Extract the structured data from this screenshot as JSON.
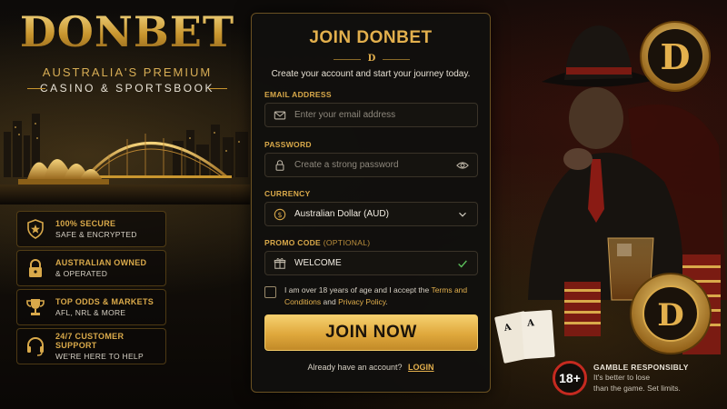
{
  "brand": {
    "logo": "DONBET",
    "tagline_1": "AUSTRALIA'S PREMIUM",
    "tagline_2": "CASINO & SPORTSBOOK"
  },
  "features": [
    {
      "icon": "shield-star-icon",
      "title": "100% SECURE",
      "subtitle": "SAFE & ENCRYPTED"
    },
    {
      "icon": "padlock-icon",
      "title": "AUSTRALIAN OWNED",
      "subtitle": "& OPERATED"
    },
    {
      "icon": "trophy-icon",
      "title": "TOP ODDS & MARKETS",
      "subtitle": "AFL, NRL & MORE"
    },
    {
      "icon": "headset-icon",
      "title": "24/7 CUSTOMER SUPPORT",
      "subtitle": "WE'RE HERE TO HELP"
    }
  ],
  "form": {
    "title": "JOIN DONBET",
    "mark": "D",
    "subtitle": "Create your account and start your journey today.",
    "email": {
      "label": "EMAIL ADDRESS",
      "placeholder": "Enter your email address"
    },
    "password": {
      "label": "PASSWORD",
      "placeholder": "Create a strong password"
    },
    "currency": {
      "label": "CURRENCY",
      "value": "Australian Dollar (AUD)"
    },
    "promo": {
      "label": "PROMO CODE",
      "label_optional": "(OPTIONAL)",
      "value": "WELCOME"
    },
    "terms": {
      "prefix": "I am over 18 years of age and I accept the",
      "terms_link": "Terms and Conditions",
      "and": "and",
      "privacy_link": "Privacy Policy",
      "suffix": "."
    },
    "submit": "JOIN NOW",
    "login_prompt": "Already have an account?",
    "login_link": "LOGIN"
  },
  "responsible": {
    "badge": "18+",
    "title": "GAMBLE RESPONSIBLY",
    "line_1": "It's better to lose",
    "line_2": "than the game. Set limits."
  },
  "colors": {
    "gold": "#e3b04d",
    "panel_border": "#6a5122",
    "button_gold": "#dfa83c",
    "badge_red": "#c52a20"
  }
}
